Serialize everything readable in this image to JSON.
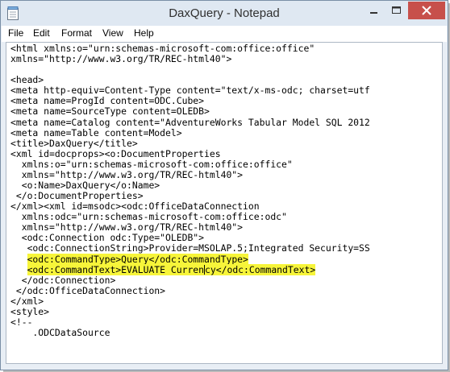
{
  "window": {
    "title": "DaxQuery - Notepad"
  },
  "menu": [
    "File",
    "Edit",
    "Format",
    "View",
    "Help"
  ],
  "colors": {
    "highlight": "#f7f53a",
    "close_button": "#c7504b",
    "titlebar": "#dfe8f2"
  },
  "editor": {
    "lines": [
      "<html xmlns:o=\"urn:schemas-microsoft-com:office:office\"",
      "xmlns=\"http://www.w3.org/TR/REC-html40\">",
      "",
      "<head>",
      "<meta http-equiv=Content-Type content=\"text/x-ms-odc; charset=utf",
      "<meta name=ProgId content=ODC.Cube>",
      "<meta name=SourceType content=OLEDB>",
      "<meta name=Catalog content=\"AdventureWorks Tabular Model SQL 2012",
      "<meta name=Table content=Model>",
      "<title>DaxQuery</title>",
      "<xml id=docprops><o:DocumentProperties",
      "  xmlns:o=\"urn:schemas-microsoft-com:office:office\"",
      "  xmlns=\"http://www.w3.org/TR/REC-html40\">",
      "  <o:Name>DaxQuery</o:Name>",
      " </o:DocumentProperties>",
      "</xml><xml id=msodc><odc:OfficeDataConnection",
      "  xmlns:odc=\"urn:schemas-microsoft-com:office:odc\"",
      "  xmlns=\"http://www.w3.org/TR/REC-html40\">",
      "  <odc:Connection odc:Type=\"OLEDB\">",
      "   <odc:ConnectionString>Provider=MSOLAP.5;Integrated Security=SS",
      "   <odc:CommandType>Query</odc:CommandType>",
      "   <odc:CommandText>EVALUATE Currency</odc:CommandText>",
      "  </odc:Connection>",
      " </odc:OfficeDataConnection>",
      "</xml>",
      "<style>",
      "<!--",
      "    .ODCDataSource"
    ],
    "highlighted_lines": [
      20,
      21
    ],
    "caret": {
      "line": 21,
      "column": 35
    }
  }
}
